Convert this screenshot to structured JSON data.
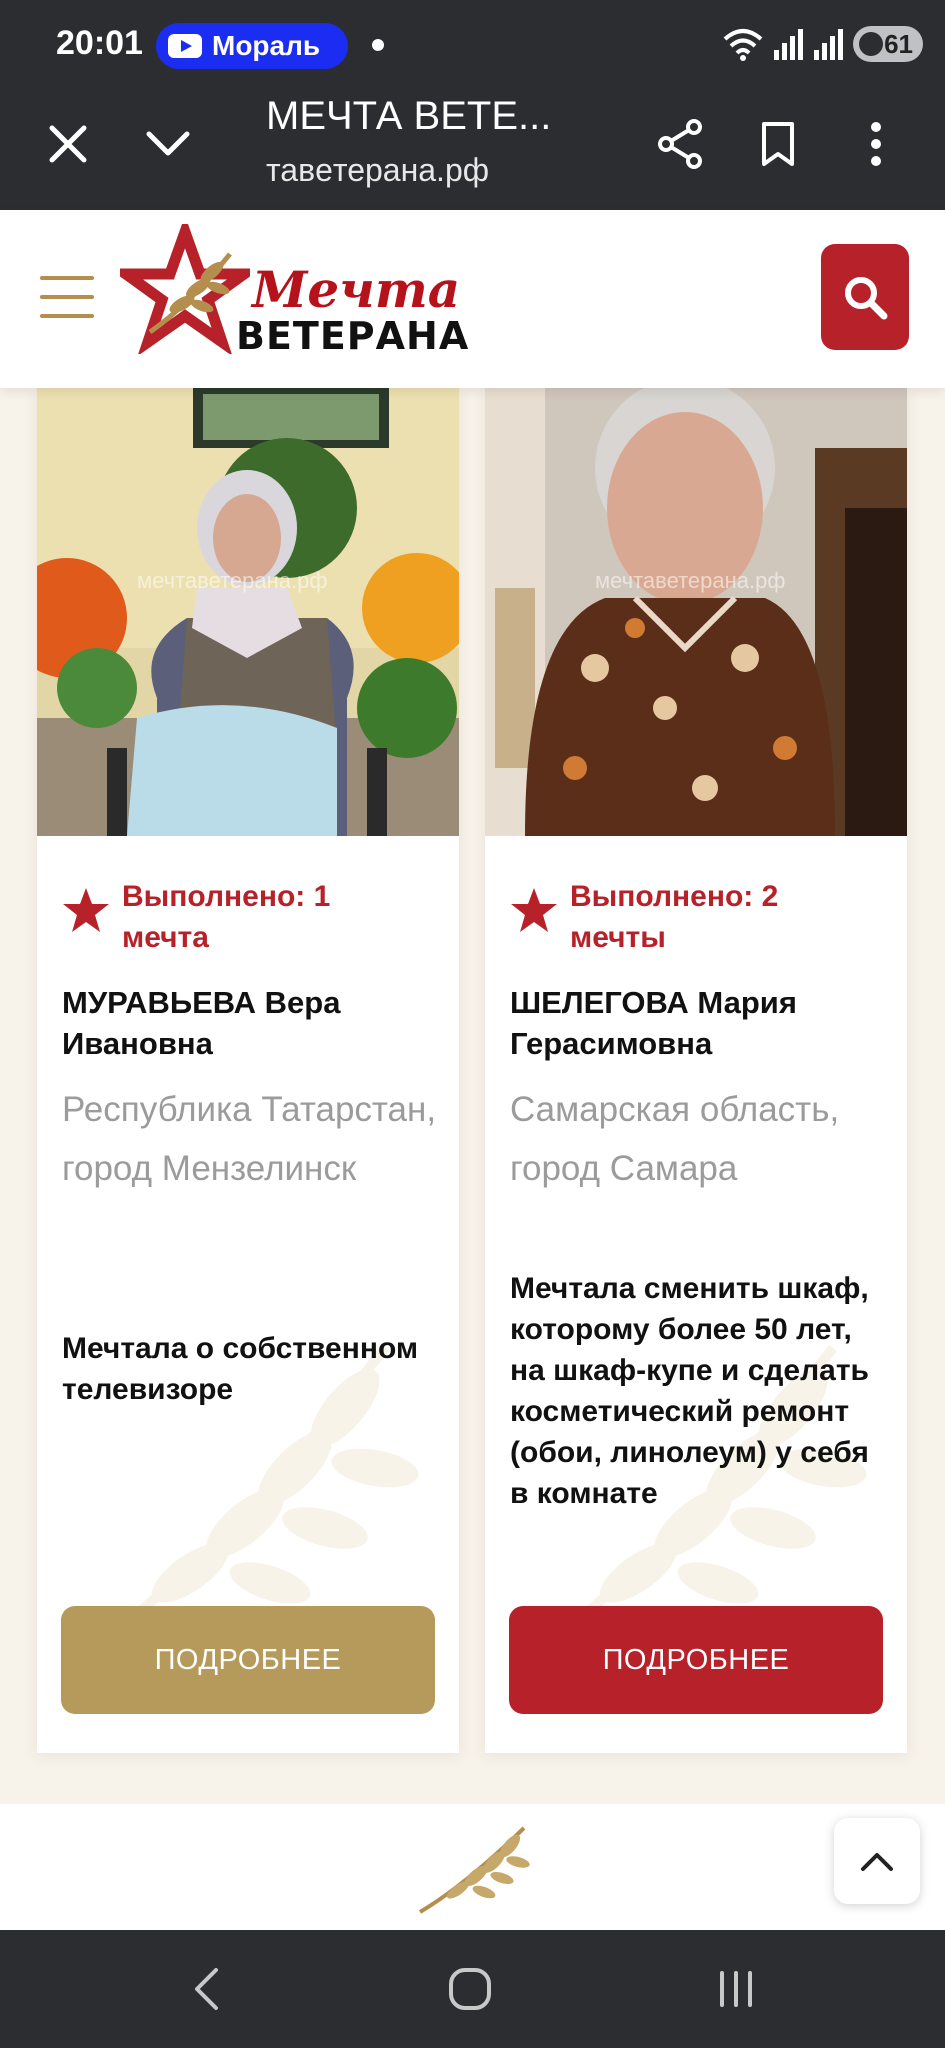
{
  "status_bar": {
    "time": "20:01",
    "notification_pill": "Мораль",
    "battery": "61",
    "icons": [
      "wifi-icon",
      "signal-icon",
      "signal-icon",
      "battery-icon"
    ]
  },
  "browser": {
    "page_title": "МЕЧТА ВЕТЕ...",
    "url": "тавeтерана.рф",
    "buttons": [
      "close-icon",
      "chevron-down-icon",
      "share-icon",
      "bookmark-icon",
      "more-vert-icon"
    ]
  },
  "site": {
    "logo_script": "Мечта",
    "logo_main": "ВЕТЕРАНА",
    "accent_red": "#b7222a",
    "accent_gold": "#b59a5b"
  },
  "cards": [
    {
      "photo_watermark": "мечтаветерана.рф",
      "status": "Выполнено: 1 мечта",
      "name": "МУРАВЬЕВА Вера Ивановна",
      "region": "Республика Татарстан, город Мензелинск",
      "dream": "Мечтала о собственном телевизоре",
      "button": "ПОДРОБНЕЕ"
    },
    {
      "photo_watermark": "мечтаветерана.рф",
      "status": "Выполнено: 2 мечты",
      "name": "ШЕЛЕГОВА Мария Герасимовна",
      "region": "Самарская область, город Самара",
      "dream": "Мечтала сменить шкаф, которому более 50 лет, на шкаф-купе и сделать косметический ремонт (обои, линолеум) у себя в комнате",
      "button": "ПОДРОБНЕЕ"
    }
  ],
  "system_nav": [
    "back-icon",
    "home-icon",
    "recents-icon"
  ]
}
